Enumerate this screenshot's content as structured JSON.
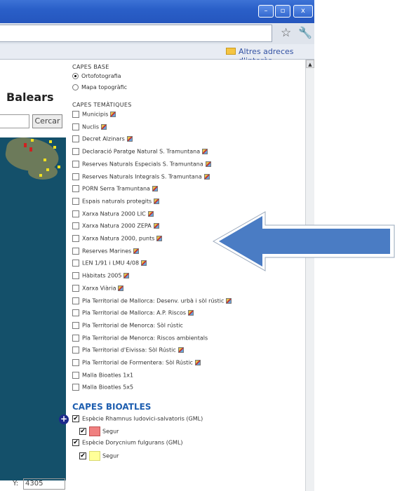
{
  "window": {
    "minimize_label": "–",
    "maximize_label": "▫",
    "close_label": "x"
  },
  "bookmarks": {
    "folder_label": "Altres adreces d'interès"
  },
  "left": {
    "title": "Balears",
    "search_button": "Cercar",
    "y_label": "Y:",
    "y_value": "4305"
  },
  "panel": {
    "base_header": "CAPES BASE",
    "base_layers": [
      {
        "label": "Ortofotografia",
        "selected": true
      },
      {
        "label": "Mapa topogràfic",
        "selected": false
      }
    ],
    "thematic_header": "CAPES TEMÀTIQUES",
    "thematic_layers": [
      {
        "label": "Municipis",
        "legend": true
      },
      {
        "label": "Nuclis",
        "legend": true
      },
      {
        "label": "Decret Alzinars",
        "legend": true
      },
      {
        "label": "Declaració Paratge Natural S. Tramuntana",
        "legend": true
      },
      {
        "label": "Reserves Naturals Especials S. Tramuntana",
        "legend": true
      },
      {
        "label": "Reserves Naturals Integrals S. Tramuntana",
        "legend": true
      },
      {
        "label": "PORN Serra Tramuntana",
        "legend": true
      },
      {
        "label": "Espais naturals protegits",
        "legend": true
      },
      {
        "label": "Xarxa Natura 2000 LIC",
        "legend": true
      },
      {
        "label": "Xarxa Natura 2000 ZEPA",
        "legend": true
      },
      {
        "label": "Xarxa Natura 2000, punts",
        "legend": true
      },
      {
        "label": "Reserves Marines",
        "legend": true
      },
      {
        "label": "LEN 1/91 i LMU 4/08",
        "legend": true
      },
      {
        "label": "Hàbitats 2005",
        "legend": true
      },
      {
        "label": "Xarxa Viària",
        "legend": true
      },
      {
        "label": "Pla Territorial de Mallorca: Desenv. urbà i sòl rústic",
        "legend": true
      },
      {
        "label": "Pla Territorial de Mallorca: A.P. Riscos",
        "legend": true
      },
      {
        "label": "Pla Territorial de Menorca: Sòl rústic",
        "legend": false
      },
      {
        "label": "Pla Territorial de Menorca: Riscos ambientals",
        "legend": false
      },
      {
        "label": "Pla Territorial d'Eivissa: Sòl Rústic",
        "legend": true
      },
      {
        "label": "Pla Territorial de Formentera: Sòl Rústic",
        "legend": true
      },
      {
        "label": "Malla Bioatles 1x1",
        "legend": false
      },
      {
        "label": "Malla Bioatles 5x5",
        "legend": false
      }
    ],
    "bioatles_header": "CAPES BIOATLES",
    "species": [
      {
        "label": "Espècie Rhamnus ludovici-salvatoris (GML)",
        "checked": true,
        "legend_label": "Segur",
        "legend_checked": true,
        "color": "#f08080"
      },
      {
        "label": "Espècie Dorycnium fulgurans (GML)",
        "checked": true,
        "legend_label": "Segur",
        "legend_checked": true,
        "color": "#ffff99"
      }
    ]
  },
  "colors": {
    "arrow_fill": "#4a7cc4",
    "arrow_outline": "#ffffff",
    "header_blue": "#1f5fb0"
  }
}
